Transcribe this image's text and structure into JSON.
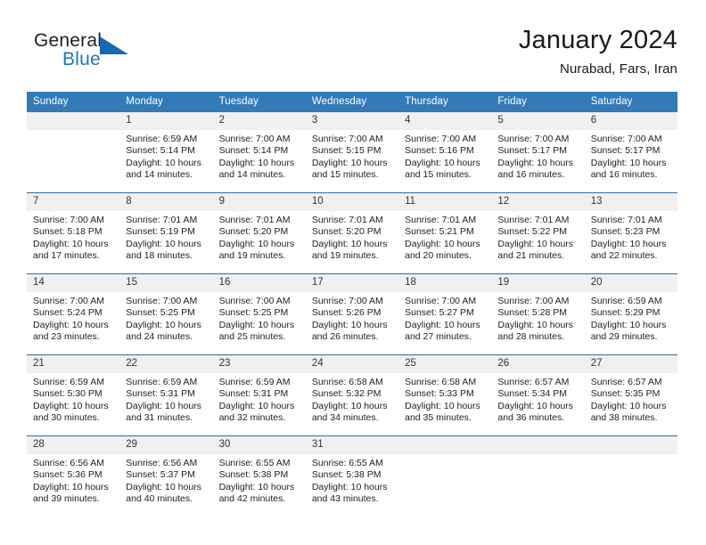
{
  "brand": {
    "name_part1": "General",
    "name_part2": "Blue",
    "accent_color": "#1668b3"
  },
  "header": {
    "title": "January 2024",
    "location": "Nurabad, Fars, Iran"
  },
  "theme": {
    "header_bg": "#337ab7",
    "row_separator": "#2b6ca3",
    "date_band_bg": "#f0f0f0"
  },
  "weekday_headers": [
    "Sunday",
    "Monday",
    "Tuesday",
    "Wednesday",
    "Thursday",
    "Friday",
    "Saturday"
  ],
  "weeks": [
    [
      {
        "day": "",
        "sunrise": "",
        "sunset": "",
        "daylight1": "",
        "daylight2": "",
        "blank": true
      },
      {
        "day": "1",
        "sunrise": "Sunrise: 6:59 AM",
        "sunset": "Sunset: 5:14 PM",
        "daylight1": "Daylight: 10 hours",
        "daylight2": "and 14 minutes."
      },
      {
        "day": "2",
        "sunrise": "Sunrise: 7:00 AM",
        "sunset": "Sunset: 5:14 PM",
        "daylight1": "Daylight: 10 hours",
        "daylight2": "and 14 minutes."
      },
      {
        "day": "3",
        "sunrise": "Sunrise: 7:00 AM",
        "sunset": "Sunset: 5:15 PM",
        "daylight1": "Daylight: 10 hours",
        "daylight2": "and 15 minutes."
      },
      {
        "day": "4",
        "sunrise": "Sunrise: 7:00 AM",
        "sunset": "Sunset: 5:16 PM",
        "daylight1": "Daylight: 10 hours",
        "daylight2": "and 15 minutes."
      },
      {
        "day": "5",
        "sunrise": "Sunrise: 7:00 AM",
        "sunset": "Sunset: 5:17 PM",
        "daylight1": "Daylight: 10 hours",
        "daylight2": "and 16 minutes."
      },
      {
        "day": "6",
        "sunrise": "Sunrise: 7:00 AM",
        "sunset": "Sunset: 5:17 PM",
        "daylight1": "Daylight: 10 hours",
        "daylight2": "and 16 minutes."
      }
    ],
    [
      {
        "day": "7",
        "sunrise": "Sunrise: 7:00 AM",
        "sunset": "Sunset: 5:18 PM",
        "daylight1": "Daylight: 10 hours",
        "daylight2": "and 17 minutes."
      },
      {
        "day": "8",
        "sunrise": "Sunrise: 7:01 AM",
        "sunset": "Sunset: 5:19 PM",
        "daylight1": "Daylight: 10 hours",
        "daylight2": "and 18 minutes."
      },
      {
        "day": "9",
        "sunrise": "Sunrise: 7:01 AM",
        "sunset": "Sunset: 5:20 PM",
        "daylight1": "Daylight: 10 hours",
        "daylight2": "and 19 minutes."
      },
      {
        "day": "10",
        "sunrise": "Sunrise: 7:01 AM",
        "sunset": "Sunset: 5:20 PM",
        "daylight1": "Daylight: 10 hours",
        "daylight2": "and 19 minutes."
      },
      {
        "day": "11",
        "sunrise": "Sunrise: 7:01 AM",
        "sunset": "Sunset: 5:21 PM",
        "daylight1": "Daylight: 10 hours",
        "daylight2": "and 20 minutes."
      },
      {
        "day": "12",
        "sunrise": "Sunrise: 7:01 AM",
        "sunset": "Sunset: 5:22 PM",
        "daylight1": "Daylight: 10 hours",
        "daylight2": "and 21 minutes."
      },
      {
        "day": "13",
        "sunrise": "Sunrise: 7:01 AM",
        "sunset": "Sunset: 5:23 PM",
        "daylight1": "Daylight: 10 hours",
        "daylight2": "and 22 minutes."
      }
    ],
    [
      {
        "day": "14",
        "sunrise": "Sunrise: 7:00 AM",
        "sunset": "Sunset: 5:24 PM",
        "daylight1": "Daylight: 10 hours",
        "daylight2": "and 23 minutes."
      },
      {
        "day": "15",
        "sunrise": "Sunrise: 7:00 AM",
        "sunset": "Sunset: 5:25 PM",
        "daylight1": "Daylight: 10 hours",
        "daylight2": "and 24 minutes."
      },
      {
        "day": "16",
        "sunrise": "Sunrise: 7:00 AM",
        "sunset": "Sunset: 5:25 PM",
        "daylight1": "Daylight: 10 hours",
        "daylight2": "and 25 minutes."
      },
      {
        "day": "17",
        "sunrise": "Sunrise: 7:00 AM",
        "sunset": "Sunset: 5:26 PM",
        "daylight1": "Daylight: 10 hours",
        "daylight2": "and 26 minutes."
      },
      {
        "day": "18",
        "sunrise": "Sunrise: 7:00 AM",
        "sunset": "Sunset: 5:27 PM",
        "daylight1": "Daylight: 10 hours",
        "daylight2": "and 27 minutes."
      },
      {
        "day": "19",
        "sunrise": "Sunrise: 7:00 AM",
        "sunset": "Sunset: 5:28 PM",
        "daylight1": "Daylight: 10 hours",
        "daylight2": "and 28 minutes."
      },
      {
        "day": "20",
        "sunrise": "Sunrise: 6:59 AM",
        "sunset": "Sunset: 5:29 PM",
        "daylight1": "Daylight: 10 hours",
        "daylight2": "and 29 minutes."
      }
    ],
    [
      {
        "day": "21",
        "sunrise": "Sunrise: 6:59 AM",
        "sunset": "Sunset: 5:30 PM",
        "daylight1": "Daylight: 10 hours",
        "daylight2": "and 30 minutes."
      },
      {
        "day": "22",
        "sunrise": "Sunrise: 6:59 AM",
        "sunset": "Sunset: 5:31 PM",
        "daylight1": "Daylight: 10 hours",
        "daylight2": "and 31 minutes."
      },
      {
        "day": "23",
        "sunrise": "Sunrise: 6:59 AM",
        "sunset": "Sunset: 5:31 PM",
        "daylight1": "Daylight: 10 hours",
        "daylight2": "and 32 minutes."
      },
      {
        "day": "24",
        "sunrise": "Sunrise: 6:58 AM",
        "sunset": "Sunset: 5:32 PM",
        "daylight1": "Daylight: 10 hours",
        "daylight2": "and 34 minutes."
      },
      {
        "day": "25",
        "sunrise": "Sunrise: 6:58 AM",
        "sunset": "Sunset: 5:33 PM",
        "daylight1": "Daylight: 10 hours",
        "daylight2": "and 35 minutes."
      },
      {
        "day": "26",
        "sunrise": "Sunrise: 6:57 AM",
        "sunset": "Sunset: 5:34 PM",
        "daylight1": "Daylight: 10 hours",
        "daylight2": "and 36 minutes."
      },
      {
        "day": "27",
        "sunrise": "Sunrise: 6:57 AM",
        "sunset": "Sunset: 5:35 PM",
        "daylight1": "Daylight: 10 hours",
        "daylight2": "and 38 minutes."
      }
    ],
    [
      {
        "day": "28",
        "sunrise": "Sunrise: 6:56 AM",
        "sunset": "Sunset: 5:36 PM",
        "daylight1": "Daylight: 10 hours",
        "daylight2": "and 39 minutes."
      },
      {
        "day": "29",
        "sunrise": "Sunrise: 6:56 AM",
        "sunset": "Sunset: 5:37 PM",
        "daylight1": "Daylight: 10 hours",
        "daylight2": "and 40 minutes."
      },
      {
        "day": "30",
        "sunrise": "Sunrise: 6:55 AM",
        "sunset": "Sunset: 5:38 PM",
        "daylight1": "Daylight: 10 hours",
        "daylight2": "and 42 minutes."
      },
      {
        "day": "31",
        "sunrise": "Sunrise: 6:55 AM",
        "sunset": "Sunset: 5:38 PM",
        "daylight1": "Daylight: 10 hours",
        "daylight2": "and 43 minutes."
      },
      {
        "day": "",
        "sunrise": "",
        "sunset": "",
        "daylight1": "",
        "daylight2": "",
        "blank": true
      },
      {
        "day": "",
        "sunrise": "",
        "sunset": "",
        "daylight1": "",
        "daylight2": "",
        "blank": true
      },
      {
        "day": "",
        "sunrise": "",
        "sunset": "",
        "daylight1": "",
        "daylight2": "",
        "blank": true
      }
    ]
  ]
}
